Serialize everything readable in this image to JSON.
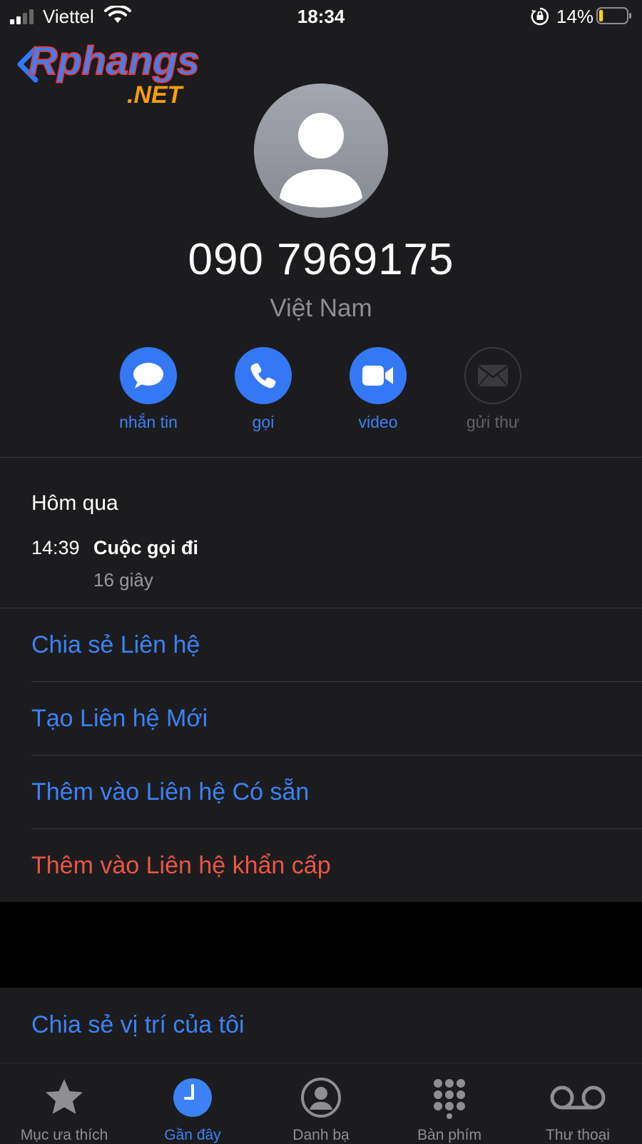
{
  "status_bar": {
    "carrier": "Viettel",
    "time": "18:34",
    "battery_percent": "14%",
    "battery_level": 0.14
  },
  "watermark": {
    "text_main": "Rphangs",
    "text_sub": ".NET"
  },
  "contact": {
    "phone_number": "090 7969175",
    "country": "Việt Nam"
  },
  "actions": [
    {
      "label": "nhắn tin",
      "icon": "message-icon",
      "enabled": true
    },
    {
      "label": "gọi",
      "icon": "phone-icon",
      "enabled": true
    },
    {
      "label": "video",
      "icon": "video-icon",
      "enabled": true
    },
    {
      "label": "gửi thư",
      "icon": "mail-icon",
      "enabled": false
    }
  ],
  "recents": {
    "header": "Hôm qua",
    "time": "14:39",
    "type": "Cuộc gọi đi",
    "duration": "16 giây"
  },
  "menu": {
    "share_contact": "Chia sẻ Liên hệ",
    "create_new_contact": "Tạo Liên hệ Mới",
    "add_to_existing": "Thêm vào Liên hệ Có sẵn",
    "add_to_emergency": "Thêm vào Liên hệ khẩn cấp",
    "share_location": "Chia sẻ vị trí của tôi"
  },
  "tabs": [
    {
      "label": "Mục ưa thích",
      "icon": "star-icon",
      "active": false
    },
    {
      "label": "Gần đây",
      "icon": "clock-icon",
      "active": true
    },
    {
      "label": "Danh bạ",
      "icon": "contacts-icon",
      "active": false
    },
    {
      "label": "Bàn phím",
      "icon": "keypad-icon",
      "active": false
    },
    {
      "label": "Thư thoại",
      "icon": "voicemail-icon",
      "active": false
    }
  ],
  "colors": {
    "accent": "#3b82f6",
    "danger": "#eb5545",
    "background": "#1c1c1e"
  }
}
